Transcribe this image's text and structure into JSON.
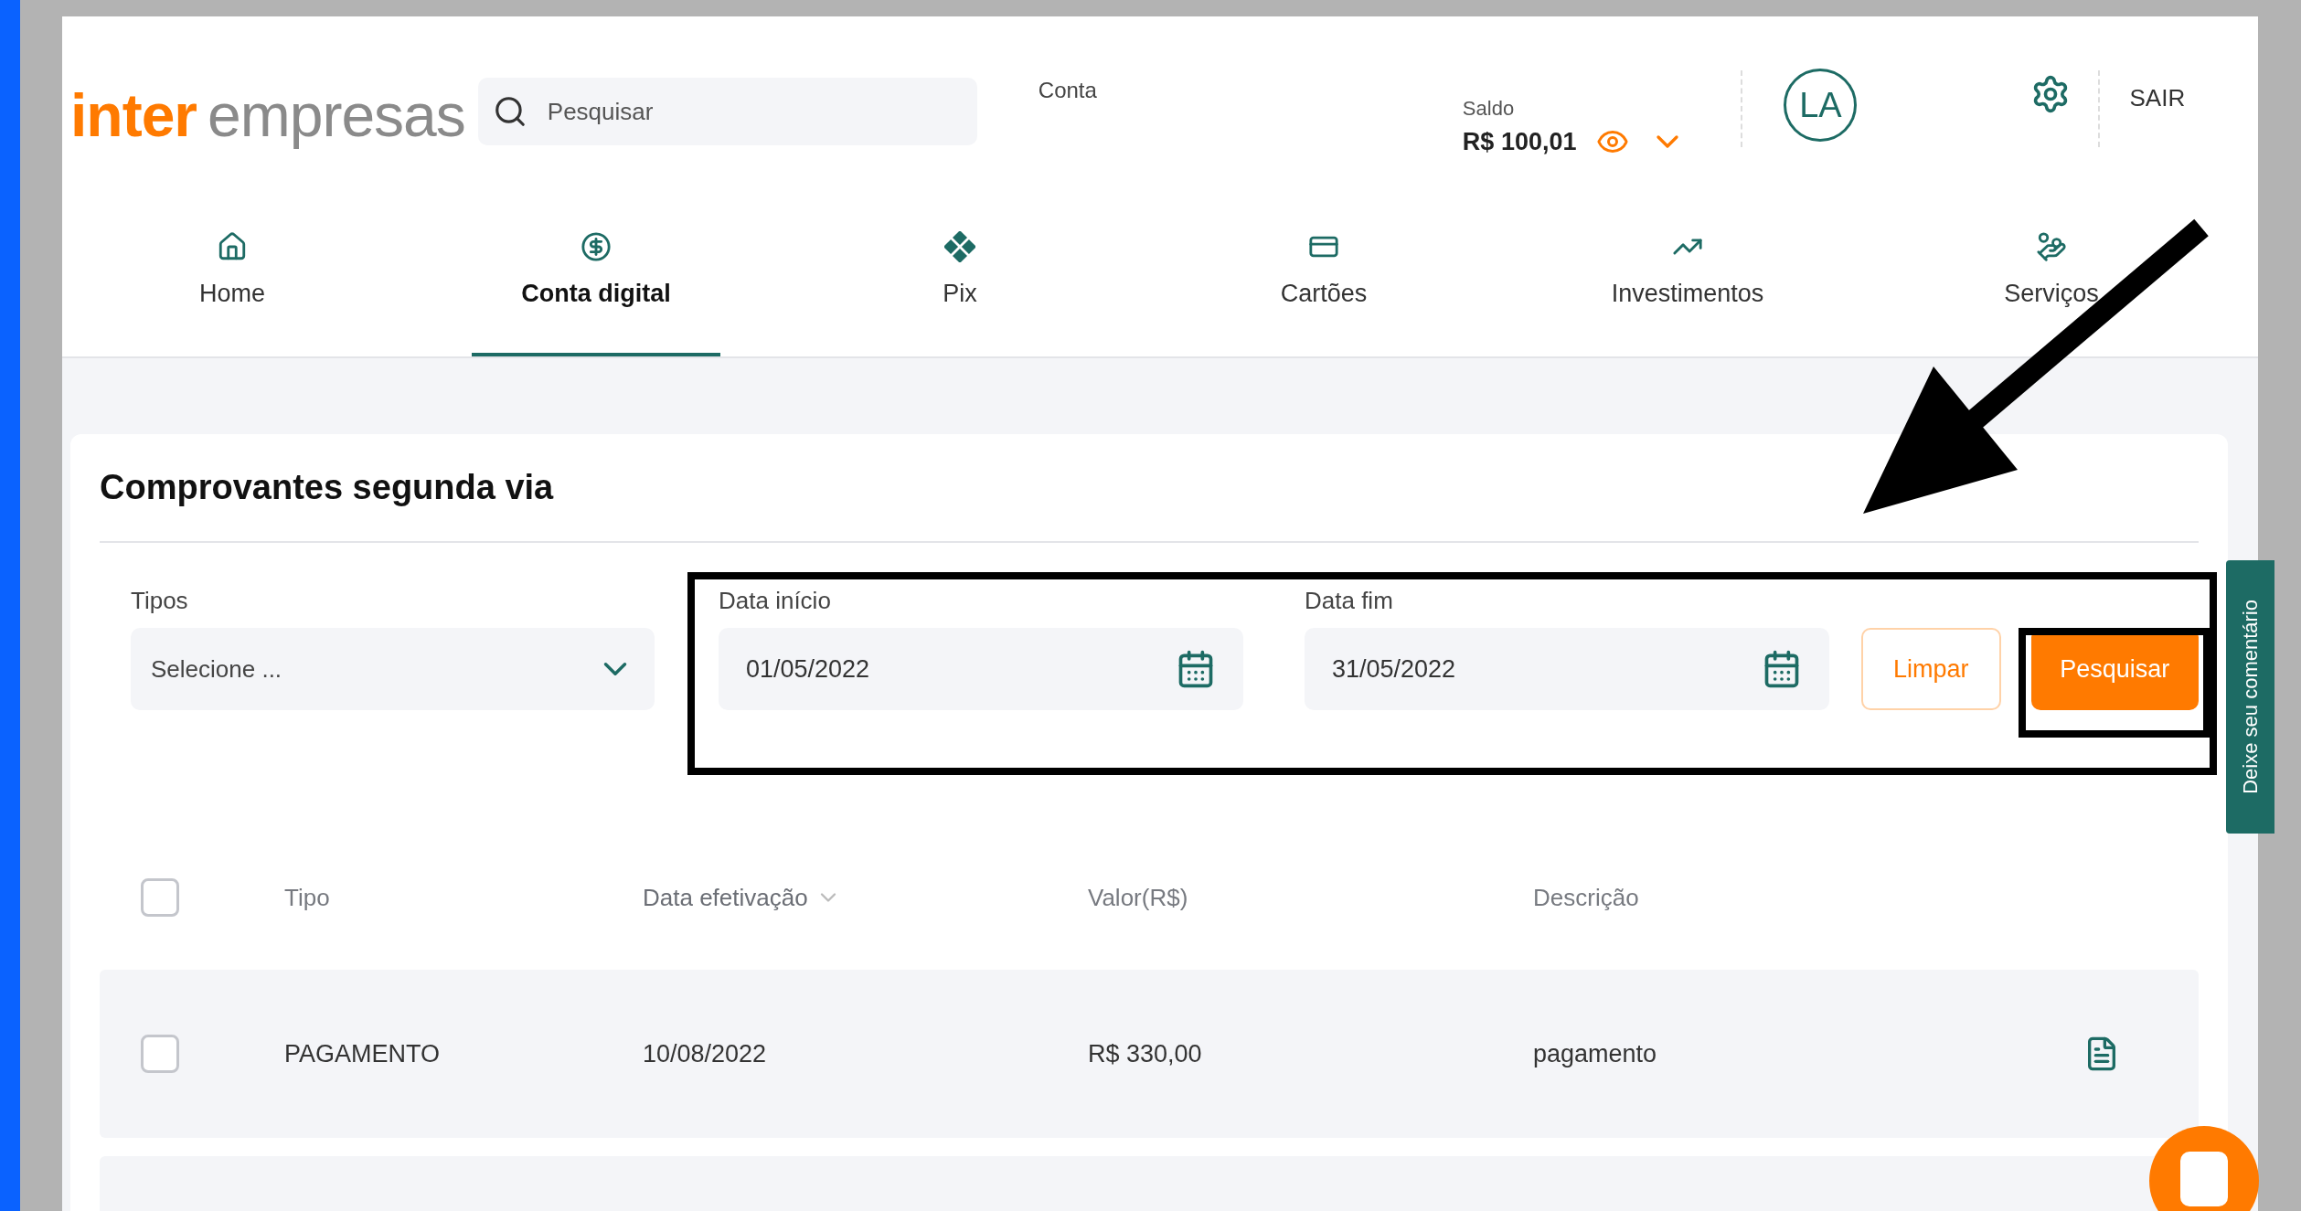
{
  "header": {
    "logo": {
      "brand": "inter",
      "suffix": "empresas"
    },
    "search": {
      "placeholder": "Pesquisar"
    },
    "account_label": "Conta",
    "balance": {
      "label": "Saldo",
      "value": "R$ 100,01"
    },
    "avatar": "LA",
    "logout": "SAIR"
  },
  "nav": [
    {
      "label": "Home",
      "selected": false
    },
    {
      "label": "Conta digital",
      "selected": true
    },
    {
      "label": "Pix",
      "selected": false
    },
    {
      "label": "Cartões",
      "selected": false
    },
    {
      "label": "Investimentos",
      "selected": false
    },
    {
      "label": "Serviços",
      "selected": false
    }
  ],
  "page": {
    "title": "Comprovantes segunda via",
    "filters": {
      "types": {
        "label": "Tipos",
        "placeholder": "Selecione ..."
      },
      "dates": [
        {
          "label": "Data início",
          "value": "01/05/2022"
        },
        {
          "label": "Data fim",
          "value": "31/05/2022"
        }
      ],
      "buttons": [
        {
          "label": "Limpar",
          "kind": "outline"
        },
        {
          "label": "Pesquisar",
          "kind": "primary"
        }
      ]
    },
    "table": {
      "select_all": {
        "checked": false
      },
      "columns": [
        {
          "label": "Tipo",
          "sortable": false
        },
        {
          "label": "Data efetivação",
          "sortable": true
        },
        {
          "label": "Valor(R$)",
          "sortable": false
        },
        {
          "label": "Descrição",
          "sortable": false
        }
      ],
      "rows": [
        {
          "checked": false,
          "cells": [
            "PAGAMENTO",
            "10/08/2022",
            "R$ 330,00",
            "pagamento"
          ]
        }
      ]
    }
  },
  "feedback_tab": "Deixe seu comentário"
}
